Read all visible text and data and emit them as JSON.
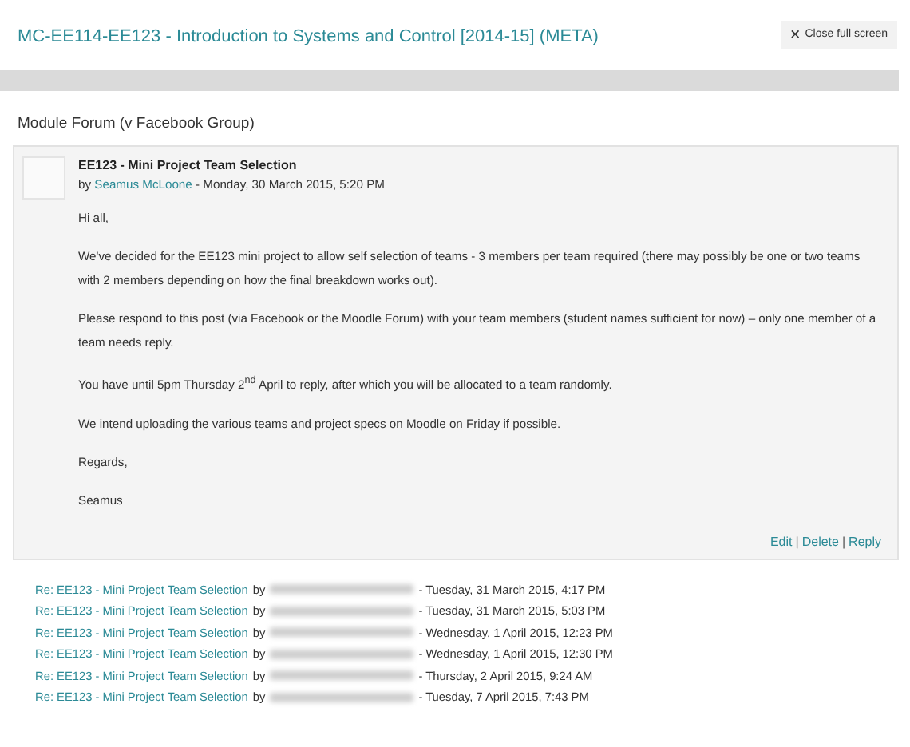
{
  "course_title": "MC-EE114-EE123 - Introduction to Systems and Control [2014-15] (META)",
  "close_button": {
    "icon": "×",
    "label": "Close full screen"
  },
  "forum_title": "Module Forum (v Facebook Group)",
  "post": {
    "subject": "EE123 - Mini Project Team Selection",
    "by": "by",
    "author": "Seamus McLoone",
    "date": "- Monday, 30 March 2015, 5:20 PM",
    "paragraphs": [
      "Hi all,",
      "We've decided for the EE123 mini project to allow self selection of teams - 3 members per team required (there may possibly be one or two teams with 2 members depending on how the final breakdown works out).",
      "Please respond to this post (via Facebook or the Moodle Forum) with your team members (student names sufficient for now) – only one member of a team needs reply.",
      "You have until 5pm Thursday 2$^{nd}$ April to reply, after which you will be allocated to a team randomly.",
      "We intend uploading the various teams and project specs on Moodle on Friday if possible.",
      "Regards,",
      "Seamus"
    ],
    "actions": [
      "Edit",
      "Delete",
      "Reply"
    ],
    "separator": "|"
  },
  "replies": [
    {
      "title": "Re: EE123 - Mini Project Team Selection",
      "by": "by",
      "date": "- Tuesday, 31 March 2015, 4:17 PM"
    },
    {
      "title": "Re: EE123 - Mini Project Team Selection",
      "by": "by",
      "date": "- Tuesday, 31 March 2015, 5:03 PM"
    },
    {
      "title": "Re: EE123 - Mini Project Team Selection",
      "by": "by",
      "date": "- Wednesday, 1 April 2015, 12:23 PM"
    },
    {
      "title": "Re: EE123 - Mini Project Team Selection",
      "by": "by",
      "date": "- Wednesday, 1 April 2015, 12:30 PM"
    },
    {
      "title": "Re: EE123 - Mini Project Team Selection",
      "by": "by",
      "date": "- Thursday, 2 April 2015, 9:24 AM"
    },
    {
      "title": "Re: EE123 - Mini Project Team Selection",
      "by": "by",
      "date": "- Tuesday, 7 April 2015, 7:43 PM"
    }
  ]
}
